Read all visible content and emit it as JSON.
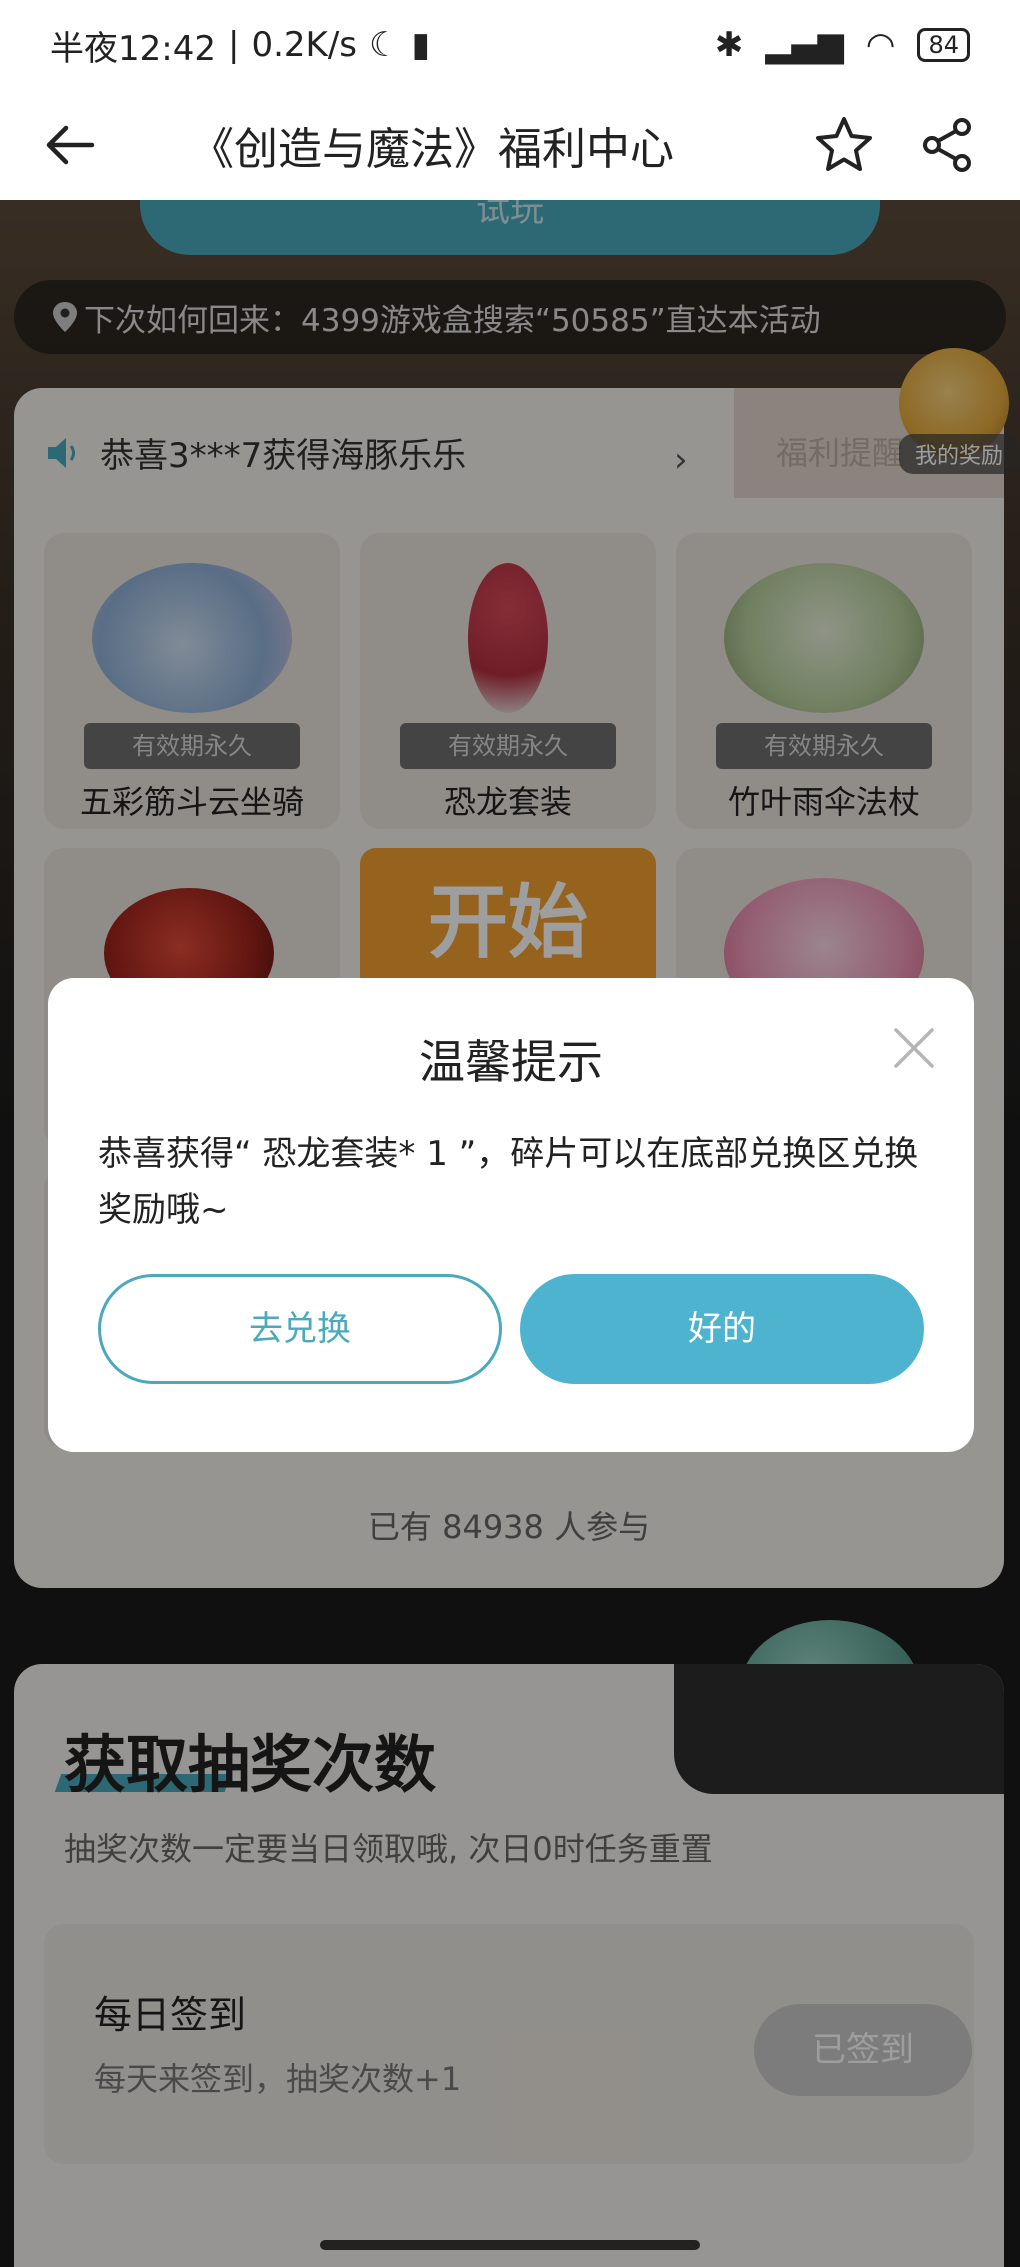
{
  "status_bar": {
    "time": "半夜12:42",
    "speed": "0.2K/s",
    "battery": "84"
  },
  "header": {
    "title": "《创造与魔法》福利中心"
  },
  "top_button_text": "试玩",
  "back_hint": "下次如何回来：4399游戏盒搜索“50585”直达本活动",
  "notice": "恭喜3***7获得海豚乐乐",
  "remind_tab": "福利提醒",
  "my_award": "我的奖励",
  "prizes": [
    {
      "badge": "有效期永久",
      "name": "五彩筋斗云坐骑"
    },
    {
      "badge": "有效期永久",
      "name": "恐龙套装"
    },
    {
      "badge": "有效期永久",
      "name": "竹叶雨伞法杖"
    }
  ],
  "start_label": "开始",
  "participants": "已有  84938  人参与",
  "task_section": {
    "title": "获取抽奖次数",
    "subtitle": "抽奖次数一定要当日领取哦, 次日0时任务重置",
    "task": {
      "name": "每日签到",
      "desc": "每天来签到，抽奖次数+1",
      "button": "已签到"
    }
  },
  "modal": {
    "title": "温馨提示",
    "body": "恭喜获得“ 恐龙套装* 1 ”，碎片可以在底部兑换区兑换奖励哦~",
    "exchange_label": "去兑换",
    "ok_label": "好的"
  },
  "colors": {
    "accent": "#4aa9bd",
    "ok_button": "#4eb3cf",
    "start_orange": "#f0a030"
  }
}
